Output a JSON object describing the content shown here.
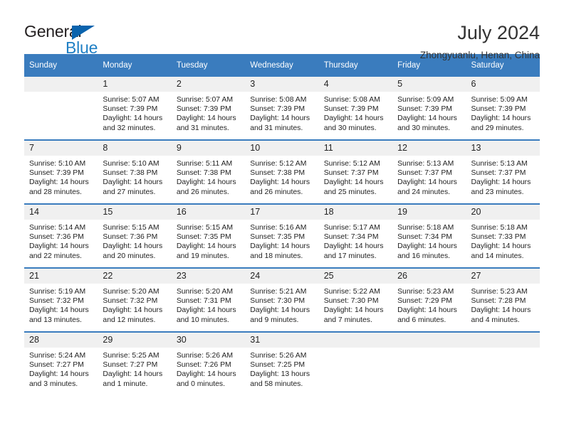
{
  "brand": {
    "name_dark": "General",
    "name_blue": "Blue",
    "triangle_color": "#0a63ad",
    "blue_text_color": "#1f7fc4"
  },
  "header": {
    "title": "July 2024",
    "location": "Zhongyuanlu, Henan, China"
  },
  "theme": {
    "header_blue": "#3a7cbe",
    "daynum_band": "#f0f0f0",
    "text": "#222222"
  },
  "weekdays": [
    "Sunday",
    "Monday",
    "Tuesday",
    "Wednesday",
    "Thursday",
    "Friday",
    "Saturday"
  ],
  "weeks": [
    [
      {
        "day": "",
        "sunrise": "",
        "sunset": "",
        "daylight_line1": "",
        "daylight_line2": ""
      },
      {
        "day": "1",
        "sunrise": "Sunrise: 5:07 AM",
        "sunset": "Sunset: 7:39 PM",
        "daylight_line1": "Daylight: 14 hours",
        "daylight_line2": "and 32 minutes."
      },
      {
        "day": "2",
        "sunrise": "Sunrise: 5:07 AM",
        "sunset": "Sunset: 7:39 PM",
        "daylight_line1": "Daylight: 14 hours",
        "daylight_line2": "and 31 minutes."
      },
      {
        "day": "3",
        "sunrise": "Sunrise: 5:08 AM",
        "sunset": "Sunset: 7:39 PM",
        "daylight_line1": "Daylight: 14 hours",
        "daylight_line2": "and 31 minutes."
      },
      {
        "day": "4",
        "sunrise": "Sunrise: 5:08 AM",
        "sunset": "Sunset: 7:39 PM",
        "daylight_line1": "Daylight: 14 hours",
        "daylight_line2": "and 30 minutes."
      },
      {
        "day": "5",
        "sunrise": "Sunrise: 5:09 AM",
        "sunset": "Sunset: 7:39 PM",
        "daylight_line1": "Daylight: 14 hours",
        "daylight_line2": "and 30 minutes."
      },
      {
        "day": "6",
        "sunrise": "Sunrise: 5:09 AM",
        "sunset": "Sunset: 7:39 PM",
        "daylight_line1": "Daylight: 14 hours",
        "daylight_line2": "and 29 minutes."
      }
    ],
    [
      {
        "day": "7",
        "sunrise": "Sunrise: 5:10 AM",
        "sunset": "Sunset: 7:39 PM",
        "daylight_line1": "Daylight: 14 hours",
        "daylight_line2": "and 28 minutes."
      },
      {
        "day": "8",
        "sunrise": "Sunrise: 5:10 AM",
        "sunset": "Sunset: 7:38 PM",
        "daylight_line1": "Daylight: 14 hours",
        "daylight_line2": "and 27 minutes."
      },
      {
        "day": "9",
        "sunrise": "Sunrise: 5:11 AM",
        "sunset": "Sunset: 7:38 PM",
        "daylight_line1": "Daylight: 14 hours",
        "daylight_line2": "and 26 minutes."
      },
      {
        "day": "10",
        "sunrise": "Sunrise: 5:12 AM",
        "sunset": "Sunset: 7:38 PM",
        "daylight_line1": "Daylight: 14 hours",
        "daylight_line2": "and 26 minutes."
      },
      {
        "day": "11",
        "sunrise": "Sunrise: 5:12 AM",
        "sunset": "Sunset: 7:37 PM",
        "daylight_line1": "Daylight: 14 hours",
        "daylight_line2": "and 25 minutes."
      },
      {
        "day": "12",
        "sunrise": "Sunrise: 5:13 AM",
        "sunset": "Sunset: 7:37 PM",
        "daylight_line1": "Daylight: 14 hours",
        "daylight_line2": "and 24 minutes."
      },
      {
        "day": "13",
        "sunrise": "Sunrise: 5:13 AM",
        "sunset": "Sunset: 7:37 PM",
        "daylight_line1": "Daylight: 14 hours",
        "daylight_line2": "and 23 minutes."
      }
    ],
    [
      {
        "day": "14",
        "sunrise": "Sunrise: 5:14 AM",
        "sunset": "Sunset: 7:36 PM",
        "daylight_line1": "Daylight: 14 hours",
        "daylight_line2": "and 22 minutes."
      },
      {
        "day": "15",
        "sunrise": "Sunrise: 5:15 AM",
        "sunset": "Sunset: 7:36 PM",
        "daylight_line1": "Daylight: 14 hours",
        "daylight_line2": "and 20 minutes."
      },
      {
        "day": "16",
        "sunrise": "Sunrise: 5:15 AM",
        "sunset": "Sunset: 7:35 PM",
        "daylight_line1": "Daylight: 14 hours",
        "daylight_line2": "and 19 minutes."
      },
      {
        "day": "17",
        "sunrise": "Sunrise: 5:16 AM",
        "sunset": "Sunset: 7:35 PM",
        "daylight_line1": "Daylight: 14 hours",
        "daylight_line2": "and 18 minutes."
      },
      {
        "day": "18",
        "sunrise": "Sunrise: 5:17 AM",
        "sunset": "Sunset: 7:34 PM",
        "daylight_line1": "Daylight: 14 hours",
        "daylight_line2": "and 17 minutes."
      },
      {
        "day": "19",
        "sunrise": "Sunrise: 5:18 AM",
        "sunset": "Sunset: 7:34 PM",
        "daylight_line1": "Daylight: 14 hours",
        "daylight_line2": "and 16 minutes."
      },
      {
        "day": "20",
        "sunrise": "Sunrise: 5:18 AM",
        "sunset": "Sunset: 7:33 PM",
        "daylight_line1": "Daylight: 14 hours",
        "daylight_line2": "and 14 minutes."
      }
    ],
    [
      {
        "day": "21",
        "sunrise": "Sunrise: 5:19 AM",
        "sunset": "Sunset: 7:32 PM",
        "daylight_line1": "Daylight: 14 hours",
        "daylight_line2": "and 13 minutes."
      },
      {
        "day": "22",
        "sunrise": "Sunrise: 5:20 AM",
        "sunset": "Sunset: 7:32 PM",
        "daylight_line1": "Daylight: 14 hours",
        "daylight_line2": "and 12 minutes."
      },
      {
        "day": "23",
        "sunrise": "Sunrise: 5:20 AM",
        "sunset": "Sunset: 7:31 PM",
        "daylight_line1": "Daylight: 14 hours",
        "daylight_line2": "and 10 minutes."
      },
      {
        "day": "24",
        "sunrise": "Sunrise: 5:21 AM",
        "sunset": "Sunset: 7:30 PM",
        "daylight_line1": "Daylight: 14 hours",
        "daylight_line2": "and 9 minutes."
      },
      {
        "day": "25",
        "sunrise": "Sunrise: 5:22 AM",
        "sunset": "Sunset: 7:30 PM",
        "daylight_line1": "Daylight: 14 hours",
        "daylight_line2": "and 7 minutes."
      },
      {
        "day": "26",
        "sunrise": "Sunrise: 5:23 AM",
        "sunset": "Sunset: 7:29 PM",
        "daylight_line1": "Daylight: 14 hours",
        "daylight_line2": "and 6 minutes."
      },
      {
        "day": "27",
        "sunrise": "Sunrise: 5:23 AM",
        "sunset": "Sunset: 7:28 PM",
        "daylight_line1": "Daylight: 14 hours",
        "daylight_line2": "and 4 minutes."
      }
    ],
    [
      {
        "day": "28",
        "sunrise": "Sunrise: 5:24 AM",
        "sunset": "Sunset: 7:27 PM",
        "daylight_line1": "Daylight: 14 hours",
        "daylight_line2": "and 3 minutes."
      },
      {
        "day": "29",
        "sunrise": "Sunrise: 5:25 AM",
        "sunset": "Sunset: 7:27 PM",
        "daylight_line1": "Daylight: 14 hours",
        "daylight_line2": "and 1 minute."
      },
      {
        "day": "30",
        "sunrise": "Sunrise: 5:26 AM",
        "sunset": "Sunset: 7:26 PM",
        "daylight_line1": "Daylight: 14 hours",
        "daylight_line2": "and 0 minutes."
      },
      {
        "day": "31",
        "sunrise": "Sunrise: 5:26 AM",
        "sunset": "Sunset: 7:25 PM",
        "daylight_line1": "Daylight: 13 hours",
        "daylight_line2": "and 58 minutes."
      },
      {
        "day": "",
        "sunrise": "",
        "sunset": "",
        "daylight_line1": "",
        "daylight_line2": ""
      },
      {
        "day": "",
        "sunrise": "",
        "sunset": "",
        "daylight_line1": "",
        "daylight_line2": ""
      },
      {
        "day": "",
        "sunrise": "",
        "sunset": "",
        "daylight_line1": "",
        "daylight_line2": ""
      }
    ]
  ]
}
